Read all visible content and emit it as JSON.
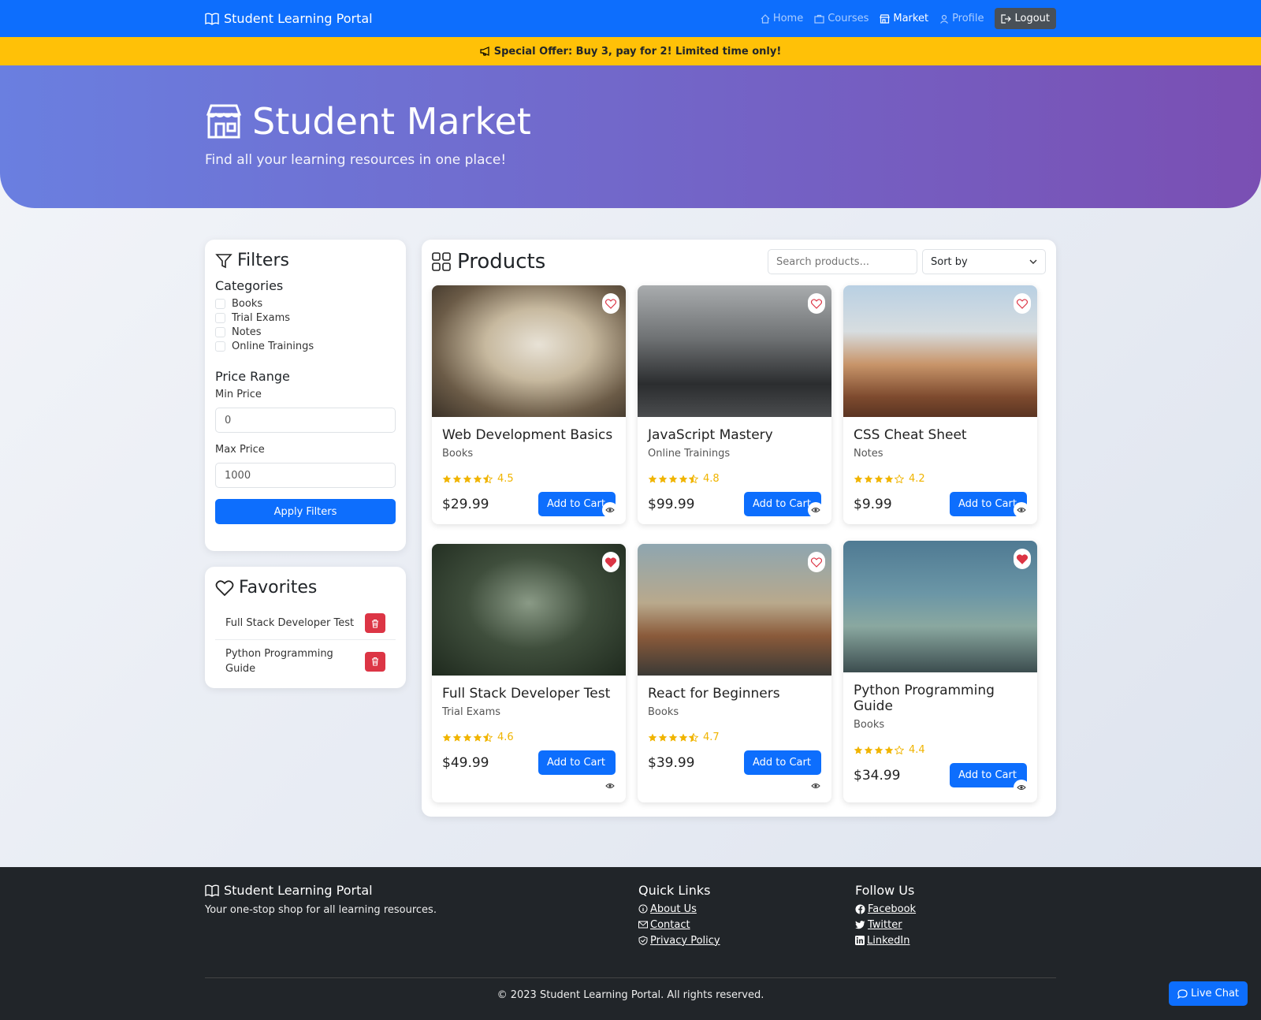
{
  "nav": {
    "brand": "Student Learning Portal",
    "links": [
      {
        "label": "Home",
        "icon": "home-icon"
      },
      {
        "label": "Courses",
        "icon": "briefcase-icon"
      },
      {
        "label": "Market",
        "icon": "shop-icon"
      },
      {
        "label": "Profile",
        "icon": "person-icon"
      }
    ],
    "logout": "Logout"
  },
  "offer": {
    "text": "Special Offer: Buy 3, pay for 2! Limited time only!",
    "icon": "megaphone-icon"
  },
  "hero": {
    "title": "Student Market",
    "subtitle": "Find all your learning resources in one place!"
  },
  "filters": {
    "title": "Filters",
    "categories_title": "Categories",
    "categories": [
      "Books",
      "Trial Exams",
      "Notes",
      "Online Trainings"
    ],
    "price_title": "Price Range",
    "min_label": "Min Price",
    "min_value": "0",
    "max_label": "Max Price",
    "max_value": "1000",
    "apply": "Apply Filters"
  },
  "favorites": {
    "title": "Favorites",
    "items": [
      "Full Stack Developer Test",
      "Python Programming Guide"
    ]
  },
  "products": {
    "title": "Products",
    "search_placeholder": "Search products...",
    "sort_label": "Sort by",
    "add_to_cart": "Add to Cart",
    "items": [
      {
        "name": "Web Development Basics",
        "category": "Books",
        "rating": "4.5",
        "stars": 4.5,
        "price": "$29.99",
        "favorite": false
      },
      {
        "name": "JavaScript Mastery",
        "category": "Online Trainings",
        "rating": "4.8",
        "stars": 4.5,
        "price": "$99.99",
        "favorite": false
      },
      {
        "name": "CSS Cheat Sheet",
        "category": "Notes",
        "rating": "4.2",
        "stars": 4,
        "price": "$9.99",
        "favorite": false
      },
      {
        "name": "Full Stack Developer Test",
        "category": "Trial Exams",
        "rating": "4.6",
        "stars": 4.5,
        "price": "$49.99",
        "favorite": true
      },
      {
        "name": "React for Beginners",
        "category": "Books",
        "rating": "4.7",
        "stars": 4.5,
        "price": "$39.99",
        "favorite": false
      },
      {
        "name": "Python Programming Guide",
        "category": "Books",
        "rating": "4.4",
        "stars": 4,
        "price": "$34.99",
        "favorite": true
      }
    ]
  },
  "footer": {
    "brand": "Student Learning Portal",
    "tagline": "Your one-stop shop for all learning resources.",
    "quick_links_title": "Quick Links",
    "quick_links": [
      "About Us",
      "Contact",
      "Privacy Policy"
    ],
    "follow_title": "Follow Us",
    "social": [
      "Facebook",
      "Twitter",
      "LinkedIn"
    ],
    "copyright": "© 2023 Student Learning Portal. All rights reserved."
  },
  "live_chat": "Live Chat",
  "colors": {
    "primary": "#0d6efd",
    "warning": "#ffc107",
    "danger": "#dc3545",
    "star": "#f0b400",
    "dark": "#212529"
  }
}
